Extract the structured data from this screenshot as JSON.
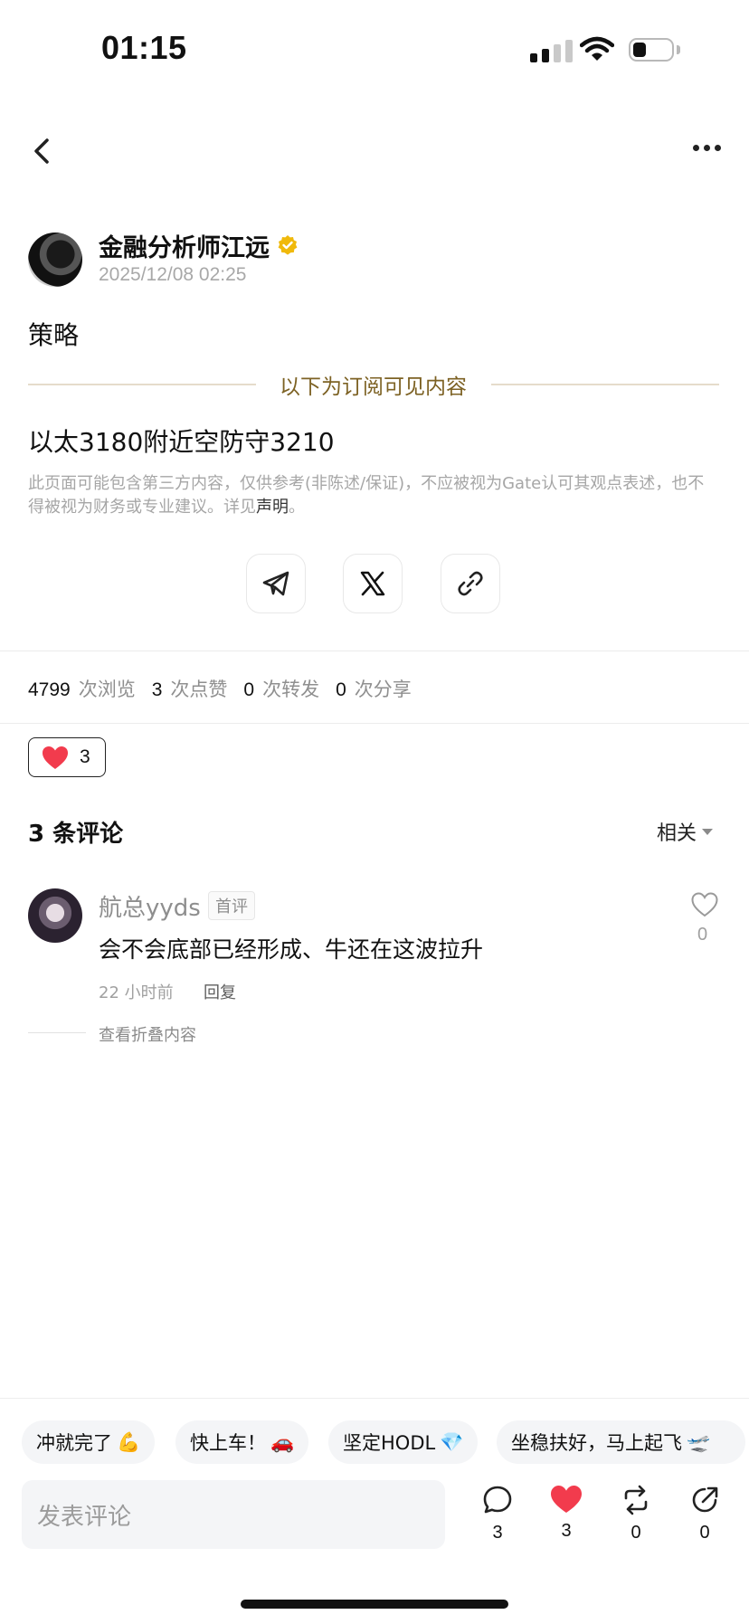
{
  "status_bar": {
    "time": "01:15"
  },
  "author": {
    "name": "金融分析师江远",
    "timestamp": "2025/12/08 02:25",
    "verified_icon": "verified-badge-icon"
  },
  "post": {
    "title": "策略",
    "subscription_divider": "以下为订阅可见内容",
    "content": "以太3180附近空防守3210",
    "disclaimer_text": "此页面可能包含第三方内容，仅供参考(非陈述/保证)，不应被视为Gate认可其观点表述，也不得被视为财务或专业建议。详见",
    "disclaimer_link": "声明",
    "disclaimer_end": "。"
  },
  "share_buttons": [
    "telegram-icon",
    "x-icon",
    "link-icon"
  ],
  "stats": {
    "views": "4799",
    "views_label": "次浏览",
    "likes": "3",
    "likes_label": "次点赞",
    "reposts": "0",
    "reposts_label": "次转发",
    "shares": "0",
    "shares_label": "次分享"
  },
  "reaction": {
    "count": "3"
  },
  "comments": {
    "title": "3 条评论",
    "sort_label": "相关",
    "items": [
      {
        "user": "航总yyds",
        "badge": "首评",
        "text": "会不会底部已经形成、牛还在这波拉升",
        "time": "22 小时前",
        "reply_label": "回复",
        "likes": "0"
      }
    ],
    "folded_label": "查看折叠内容"
  },
  "quick_replies": [
    {
      "text": "冲就完了",
      "emoji": "💪"
    },
    {
      "text": "快上车！",
      "emoji": "🚗"
    },
    {
      "text": "坚定HODL",
      "emoji": "💎"
    },
    {
      "text": "坐稳扶好，马上起飞",
      "emoji": "🛫"
    }
  ],
  "bottom_bar": {
    "input_placeholder": "发表评论",
    "comment_count": "3",
    "like_count": "3",
    "repost_count": "0",
    "share_count": "0"
  },
  "colors": {
    "accent_gold": "#7d6224",
    "like_red": "#f23b4d",
    "verified_yellow": "#f0b90b"
  }
}
